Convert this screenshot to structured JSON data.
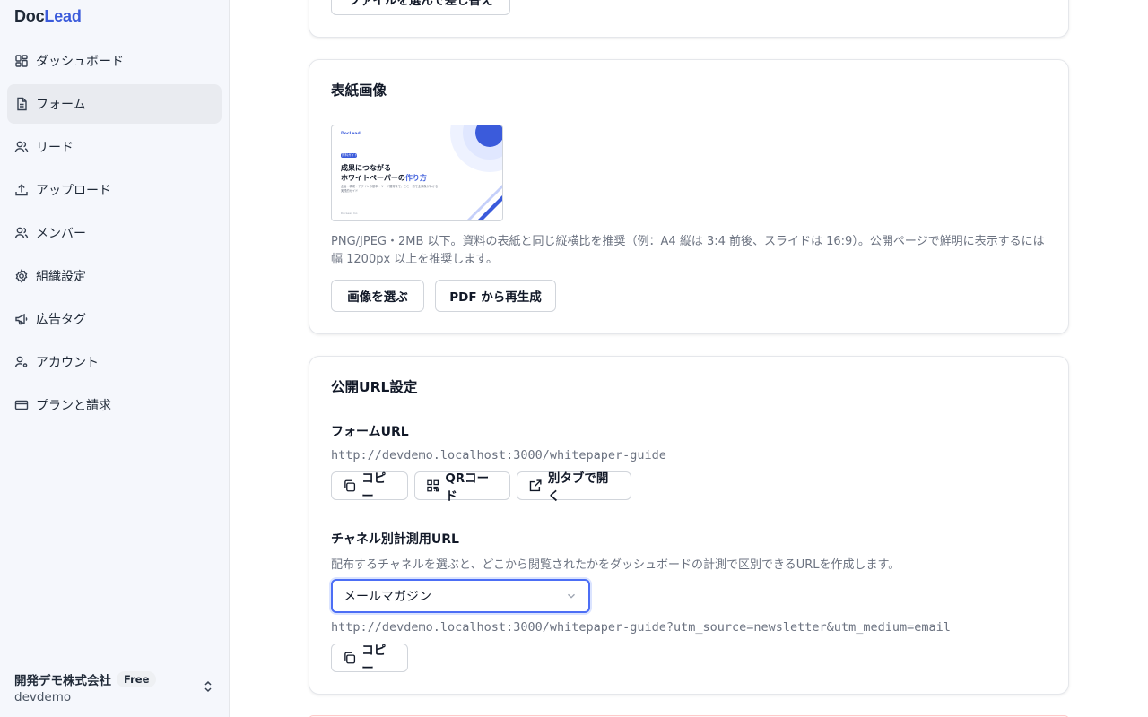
{
  "app": {
    "logo_main": "Doc",
    "logo_accent": "Lead"
  },
  "sidebar": {
    "items": [
      {
        "label": "ダッシュボード",
        "icon": "dashboard-icon"
      },
      {
        "label": "フォーム",
        "icon": "form-icon",
        "active": true
      },
      {
        "label": "リード",
        "icon": "users-icon"
      },
      {
        "label": "アップロード",
        "icon": "upload-icon"
      },
      {
        "label": "メンバー",
        "icon": "members-icon"
      },
      {
        "label": "組織設定",
        "icon": "gear-icon"
      },
      {
        "label": "広告タグ",
        "icon": "megaphone-icon"
      },
      {
        "label": "アカウント",
        "icon": "account-icon"
      },
      {
        "label": "プランと請求",
        "icon": "credit-card-icon"
      }
    ],
    "org": {
      "name": "開発デモ株式会社",
      "plan": "Free",
      "slug": "devdemo"
    }
  },
  "top_card": {
    "replace_button": "ファイルを選んで差し替え"
  },
  "cover_card": {
    "title": "表紙画像",
    "thumb": {
      "brand": "DocLead",
      "tag": "資料ガイド",
      "line1": "成果につながる",
      "line2": "ホワイトペーパーの",
      "line2_accent": "作り方",
      "sub1": "企画・構成・デザインの基本・リード獲得まで、ここ一冊で全体像がわかる",
      "sub2": "実践的ガイド",
      "footer": "DocLead Inc."
    },
    "help": "PNG/JPEG・2MB 以下。資料の表紙と同じ縦横比を推奨（例：A4 縦は 3:4 前後、スライドは 16:9）。公開ページで鮮明に表示するには幅 1200px 以上を推奨します。",
    "choose_button": "画像を選ぶ",
    "regen_button": "PDF から再生成"
  },
  "url_card": {
    "title": "公開URL設定",
    "form_url_label": "フォームURL",
    "form_url": "http://devdemo.localhost:3000/whitepaper-guide",
    "copy_button": "コピー",
    "qr_button": "QRコード",
    "open_button": "別タブで開く",
    "channel_label": "チャネル別計測用URL",
    "channel_help": "配布するチャネルを選ぶと、どこから閲覧されたかをダッシュボードの計測で区別できるURLを作成します。",
    "channel_selected": "メールマガジン",
    "channel_url": "http://devdemo.localhost:3000/whitepaper-guide?utm_source=newsletter&utm_medium=email",
    "channel_copy_button": "コピー"
  },
  "colors": {
    "accent": "#3b5bdb",
    "sidebar_bg": "#f5f7fc"
  }
}
